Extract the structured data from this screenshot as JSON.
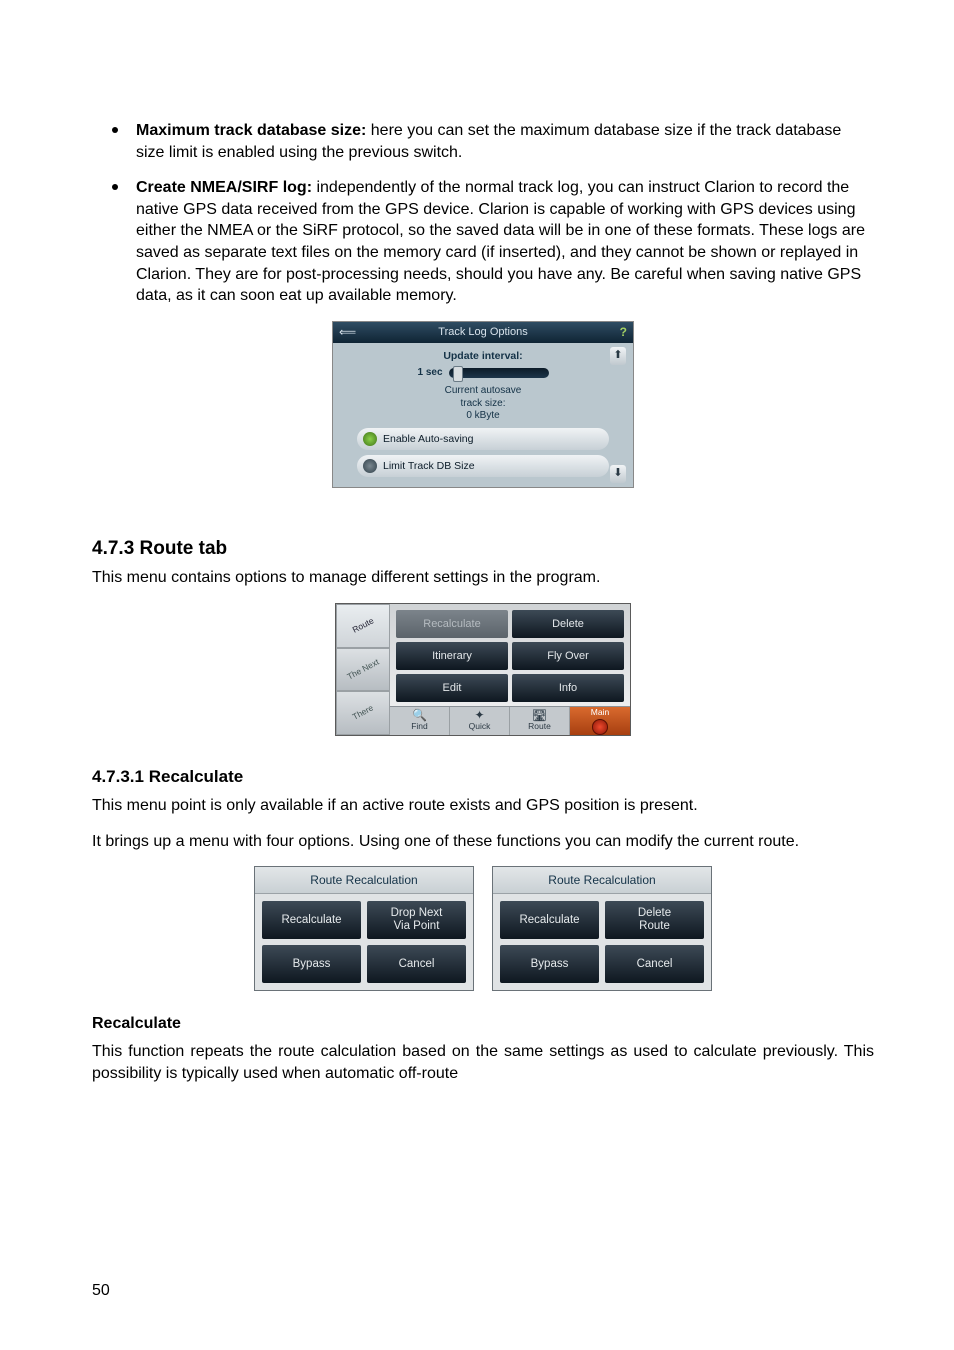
{
  "bullets": [
    {
      "lead": "Maximum track database size:",
      "text": " here you can set the maximum database size if the track database size limit is enabled using the previous switch."
    },
    {
      "lead": "Create NMEA/SIRF log:",
      "text": " independently of the normal track log, you can instruct Clarion to record the native GPS data received from the GPS device. Clarion is capable of working with GPS devices using either the NMEA or the SiRF protocol, so the saved data will be in one of these formats. These logs are saved as separate text files on the memory card (if inserted), and they cannot be shown or replayed in Clarion. They are for post-processing needs, should you have any. Be careful when saving native GPS data, as it can soon eat up available memory."
    }
  ],
  "tracklog": {
    "title": "Track Log Options",
    "back_glyph": "⟸",
    "help_glyph": "?",
    "update_interval_label": "Update interval:",
    "seconds_label": "1 sec",
    "autosave_label1": "Current autosave",
    "autosave_label2": "track size:",
    "autosave_label3": "0 kByte",
    "toggle1": "Enable Auto-saving",
    "toggle2": "Limit Track DB Size",
    "up_glyph": "⬆",
    "down_glyph": "⬇"
  },
  "section473": {
    "heading": "4.7.3  Route tab",
    "intro": "This menu contains options to manage different settings in the program."
  },
  "routetab": {
    "side_tabs": [
      "Route",
      "The Next",
      "There"
    ],
    "buttons": {
      "recalculate": "Recalculate",
      "delete": "Delete",
      "itinerary": "Itinerary",
      "flyover": "Fly Over",
      "edit": "Edit",
      "info": "Info"
    },
    "bottom": {
      "find": "Find",
      "quick": "Quick",
      "route": "Route",
      "main": "Main"
    }
  },
  "section4731": {
    "heading": "4.7.3.1  Recalculate",
    "p1": "This menu point is only available if an active route exists and GPS position is present.",
    "p2": "It brings up a menu with four options. Using one of these functions you can modify the current route."
  },
  "recalc_dialogs": {
    "title": "Route Recalculation",
    "left": {
      "recalculate": "Recalculate",
      "drop_next": "Drop Next\nVia Point",
      "bypass": "Bypass",
      "cancel": "Cancel"
    },
    "right": {
      "recalculate": "Recalculate",
      "delete_route": "Delete\nRoute",
      "bypass": "Bypass",
      "cancel": "Cancel"
    }
  },
  "recalculate_section": {
    "heading": "Recalculate",
    "p": "This function repeats the route calculation based on the same settings as used to calculate previously. This possibility is typically used when automatic off-route"
  },
  "page_number": "50"
}
